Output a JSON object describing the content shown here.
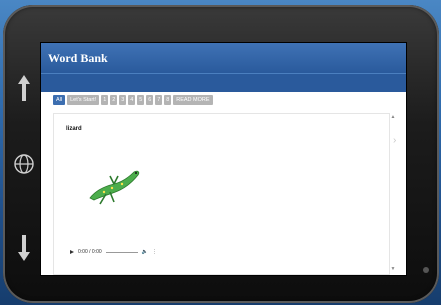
{
  "window": {
    "title": "Word Bank"
  },
  "tabs": [
    "All",
    "Let's Start!",
    "1",
    "2",
    "3",
    "4",
    "5",
    "6",
    "7",
    "8",
    "READ MORE"
  ],
  "active_tab_index": 0,
  "word": {
    "title": "lizard"
  },
  "audio": {
    "time": "0:00 / 0:00"
  },
  "colors": {
    "accent": "#2a5a9c",
    "tab_inactive": "#b4b4b4",
    "lizard": "#4cad4c"
  },
  "icons": {
    "up": "arrow-up-icon",
    "down": "arrow-down-icon",
    "globe": "globe-icon"
  }
}
